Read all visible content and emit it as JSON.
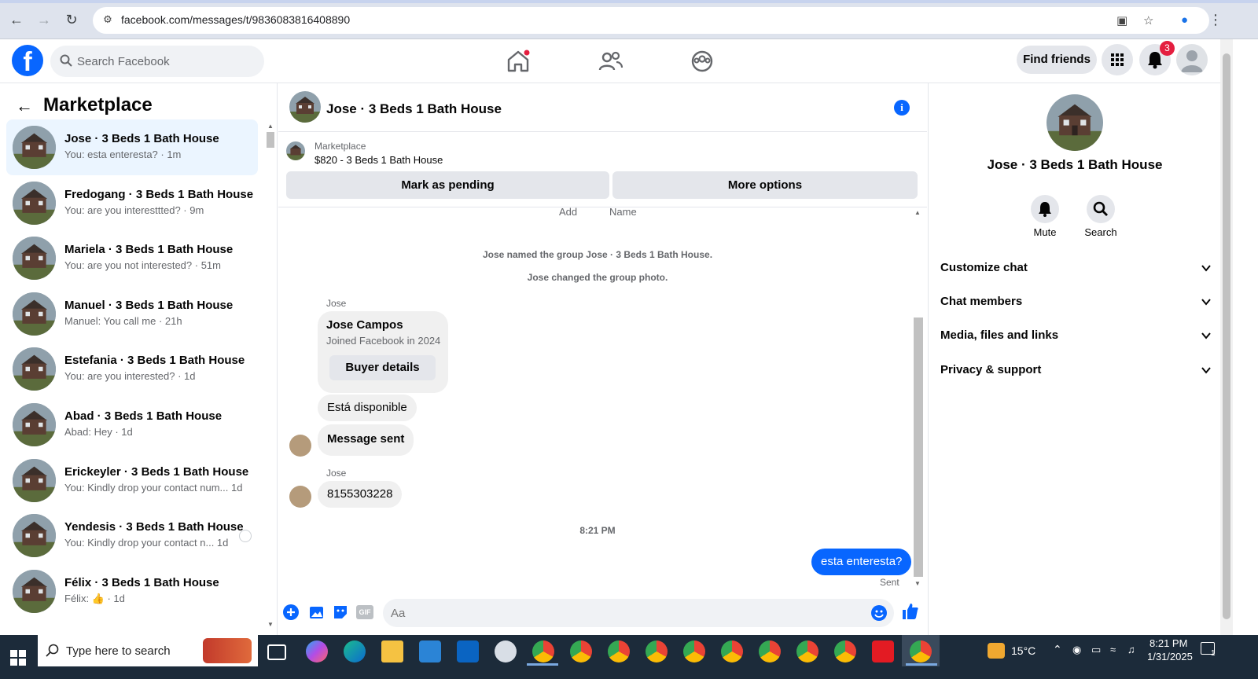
{
  "browser": {
    "url": "facebook.com/messages/t/9836083816408890"
  },
  "fb_header": {
    "search_placeholder": "Search Facebook",
    "find_friends": "Find friends",
    "notifications_count": "3"
  },
  "sidebar": {
    "title": "Marketplace",
    "conversations": [
      {
        "name": "Jose · 3 Beds 1 Bath House",
        "snippet": "You: esta enteresta? · 1m"
      },
      {
        "name": "Fredogang · 3 Beds 1 Bath House",
        "snippet": "You: are you interesttted? · 9m"
      },
      {
        "name": "Mariela · 3 Beds 1 Bath House",
        "snippet": "You: are you not interested? · 51m"
      },
      {
        "name": "Manuel · 3 Beds 1 Bath House",
        "snippet": "Manuel: You call me · 21h"
      },
      {
        "name": "Estefania · 3 Beds 1 Bath House",
        "snippet": "You: are you interested? · 1d"
      },
      {
        "name": "Abad · 3 Beds 1 Bath House",
        "snippet": "Abad: Hey · 1d"
      },
      {
        "name": "Erickeyler · 3 Beds 1 Bath House",
        "snippet": "You: Kindly drop your contact num...  1d"
      },
      {
        "name": "Yendesis · 3 Beds 1 Bath House",
        "snippet": "You: Kindly drop your contact n...  1d"
      },
      {
        "name": "Félix · 3 Beds 1 Bath House",
        "snippet": "Félix: 👍 · 1d"
      }
    ]
  },
  "chat": {
    "title": "Jose · 3 Beds 1 Bath House",
    "listing_source": "Marketplace",
    "listing_title": "$820 - 3 Beds 1 Bath House",
    "mark_pending": "Mark as pending",
    "more_options": "More options",
    "cut_text_left": "Add",
    "cut_text_right": "Name",
    "system_1": "Jose named the group Jose · 3 Beds 1 Bath House.",
    "system_2": "Jose changed the group photo.",
    "sender_1": "Jose",
    "card_name": "Jose Campos",
    "card_joined": "Joined Facebook in 2024",
    "card_button": "Buyer details",
    "msg_available": "Está disponible",
    "msg_sent": "Message sent",
    "sender_2": "Jose",
    "msg_phone": "8155303228",
    "timestamp": "8:21 PM",
    "msg_out": "esta enteresta?",
    "status": "Sent",
    "composer_placeholder": "Aa"
  },
  "details": {
    "name": "Jose · 3 Beds 1 Bath House",
    "mute": "Mute",
    "search": "Search",
    "sections": [
      "Customize chat",
      "Chat members",
      "Media, files and links",
      "Privacy & support"
    ]
  },
  "taskbar": {
    "search_placeholder": "Type here to search",
    "weather": "15°C",
    "time": "8:21 PM",
    "date": "1/31/2025",
    "notif_count": "1"
  },
  "colors": {
    "fb_blue": "#0866ff",
    "bubble_gray": "#f0f0f0",
    "active_row": "#ebf5ff",
    "taskbar": "#1c2b3a"
  }
}
